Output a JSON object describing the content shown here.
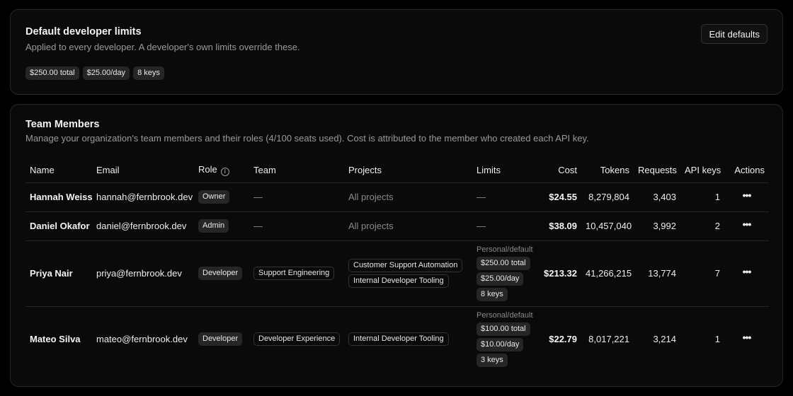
{
  "defaults": {
    "title": "Default developer limits",
    "description": "Applied to every developer. A developer's own limits override these.",
    "edit_label": "Edit defaults",
    "chips": [
      "$250.00 total",
      "$25.00/day",
      "8 keys"
    ]
  },
  "team": {
    "title": "Team Members",
    "description": "Manage your organization's team members and their roles (4/100 seats used). Cost is attributed to the member who created each API key.",
    "columns": {
      "name": "Name",
      "email": "Email",
      "role": "Role",
      "team": "Team",
      "projects": "Projects",
      "limits": "Limits",
      "cost": "Cost",
      "tokens": "Tokens",
      "requests": "Requests",
      "api_keys": "API keys",
      "actions": "Actions"
    },
    "actions_glyph": "•••",
    "members": [
      {
        "name": "Hannah Weiss",
        "email": "hannah@fernbrook.dev",
        "role": "Owner",
        "team": "—",
        "projects_text": "All projects",
        "limits_text": "—",
        "cost": "$24.55",
        "tokens": "8,279,804",
        "requests": "3,403",
        "api_keys": "1"
      },
      {
        "name": "Daniel Okafor",
        "email": "daniel@fernbrook.dev",
        "role": "Admin",
        "team": "—",
        "projects_text": "All projects",
        "limits_text": "—",
        "cost": "$38.09",
        "tokens": "10,457,040",
        "requests": "3,992",
        "api_keys": "2"
      },
      {
        "name": "Priya Nair",
        "email": "priya@fernbrook.dev",
        "role": "Developer",
        "team": "Support Engineering",
        "projects": [
          "Customer Support Automation",
          "Internal Developer Tooling"
        ],
        "limits_label": "Personal/default",
        "limits": [
          "$250.00 total",
          "$25.00/day",
          "8 keys"
        ],
        "cost": "$213.32",
        "tokens": "41,266,215",
        "requests": "13,774",
        "api_keys": "7"
      },
      {
        "name": "Mateo Silva",
        "email": "mateo@fernbrook.dev",
        "role": "Developer",
        "team": "Developer Experience",
        "projects": [
          "Internal Developer Tooling"
        ],
        "limits_label": "Personal/default",
        "limits": [
          "$100.00 total",
          "$10.00/day",
          "3 keys"
        ],
        "cost": "$22.79",
        "tokens": "8,017,221",
        "requests": "3,214",
        "api_keys": "1"
      }
    ]
  }
}
